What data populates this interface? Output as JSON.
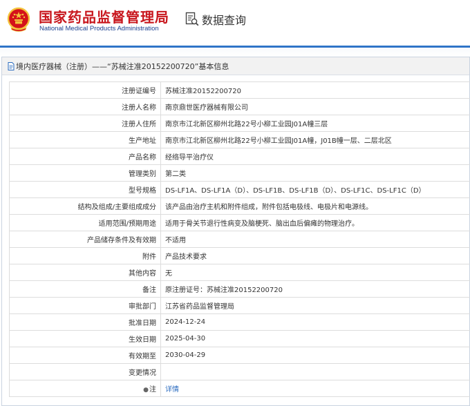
{
  "header": {
    "agency_cn": "国家药品监督管理局",
    "agency_en": "National Medical Products Administration",
    "query_label": "数据查询",
    "query_icon": "search-document-icon",
    "emblem_icon": "national-emblem-icon"
  },
  "panel": {
    "title": "境内医疗器械（注册）——“苏械注准20152200720”基本信息",
    "title_icon": "document-icon"
  },
  "rows": [
    {
      "label": "注册证编号",
      "value": "苏械注准20152200720"
    },
    {
      "label": "注册人名称",
      "value": "南京鼎世医疗器械有限公司"
    },
    {
      "label": "注册人住所",
      "value": "南京市江北新区柳州北路22号小柳工业园J01A幢三层"
    },
    {
      "label": "生产地址",
      "value": "南京市江北新区柳州北路22号小柳工业园J01A幢，J01B幢一层、二层北区"
    },
    {
      "label": "产品名称",
      "value": "经络导平治疗仪"
    },
    {
      "label": "管理类别",
      "value": "第二类"
    },
    {
      "label": "型号规格",
      "value": "DS-LF1A、DS-LF1A（D）、DS-LF1B、DS-LF1B（D）、DS-LF1C、DS-LF1C（D）"
    },
    {
      "label": "结构及组成/主要组成成分",
      "value": "该产品由治疗主机和附件组成，附件包括电极线、电极片和电源线。"
    },
    {
      "label": "适用范围/预期用途",
      "value": "适用于骨关节退行性病变及脑梗死、脑出血后偏瘫的物理治疗。"
    },
    {
      "label": "产品储存条件及有效期",
      "value": "不适用"
    },
    {
      "label": "附件",
      "value": "产品技术要求"
    },
    {
      "label": "其他内容",
      "value": "无"
    },
    {
      "label": "备注",
      "value": "原注册证号：苏械注准20152200720"
    },
    {
      "label": "审批部门",
      "value": "江苏省药品监督管理局"
    },
    {
      "label": "批准日期",
      "value": "2024-12-24"
    },
    {
      "label": "生效日期",
      "value": "2025-04-30"
    },
    {
      "label": "有效期至",
      "value": "2030-04-29"
    },
    {
      "label": "变更情况",
      "value": ""
    }
  ],
  "note": {
    "label": "注",
    "label_icon": "pin-icon",
    "link": "详情"
  },
  "colors": {
    "brand_red": "#c8161d",
    "brand_blue": "#1b3f8f",
    "rule_blue": "#2f74c8",
    "link_blue": "#2a6bbf"
  }
}
